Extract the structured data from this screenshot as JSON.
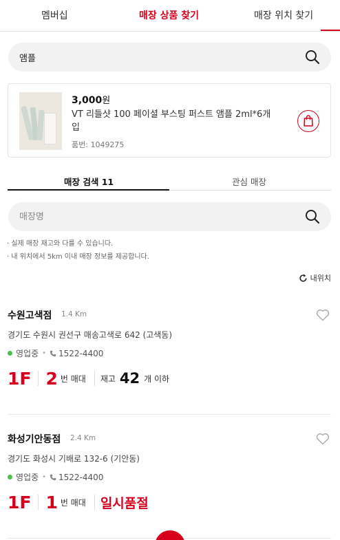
{
  "top_tabs": [
    "멤버십",
    "매장 상품 찾기",
    "매장 위치 찾기"
  ],
  "product_search": {
    "value": "앰플"
  },
  "product": {
    "price": "3,000",
    "currency": "원",
    "name": "VT 리들샷 100 페이셜 부스팅 퍼스트 앰플 2ml*6개입",
    "code": "품번: 1049275"
  },
  "sub_tabs": [
    "매장 검색 11",
    "관심 매장"
  ],
  "store_search": {
    "placeholder": "매장명"
  },
  "notes": [
    "실제 매장 재고와 다를 수 있습니다.",
    "내 위치에서 5km 이내 매장 정보를 제공합니다."
  ],
  "my_location_label": "내위치",
  "stores": [
    {
      "name": "수원고색점",
      "distance": "1.4 Km",
      "address": "경기도 수원시 권선구 매송고색로 642 (고색동)",
      "status": "영업중",
      "phone": "1522-4400",
      "floor": "1F",
      "shelf_num": "2",
      "shelf_label": "번 매대",
      "stock_label": "재고",
      "stock_num": "42",
      "stock_suffix": "개 이하"
    },
    {
      "name": "화성기안동점",
      "distance": "2.4 Km",
      "address": "경기도 화성시 기배로 132-6 (기안동)",
      "status": "영업중",
      "phone": "1522-4400",
      "floor": "1F",
      "shelf_num": "1",
      "shelf_label": "번 매대",
      "soldout": "일시품절"
    }
  ],
  "colors": {
    "accent": "#d6001c",
    "open_dot": "#4cbf4c"
  }
}
